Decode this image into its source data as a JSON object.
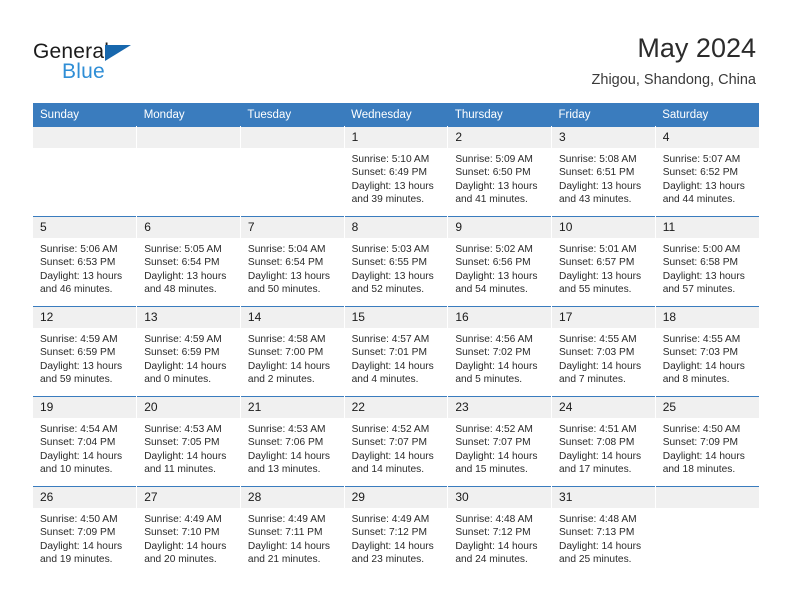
{
  "brand": {
    "name_part1": "General",
    "name_part2": "Blue",
    "triangle_color": "#1767ad",
    "blue_color": "#2f8ed6"
  },
  "header": {
    "title": "May 2024",
    "subtitle": "Zhigou, Shandong, China"
  },
  "theme": {
    "header_row_bg": "#3a7cbe",
    "daynum_bg": "#f0f0f0",
    "cell_bg": "#ffffff",
    "text_color": "#2a2a2a"
  },
  "weekday_headers": [
    "Sunday",
    "Monday",
    "Tuesday",
    "Wednesday",
    "Thursday",
    "Friday",
    "Saturday"
  ],
  "weeks": [
    [
      {
        "day": "",
        "empty": true,
        "sunrise": "",
        "sunset": "",
        "daylight_line1": "",
        "daylight_line2": ""
      },
      {
        "day": "",
        "empty": true,
        "sunrise": "",
        "sunset": "",
        "daylight_line1": "",
        "daylight_line2": ""
      },
      {
        "day": "",
        "empty": true,
        "sunrise": "",
        "sunset": "",
        "daylight_line1": "",
        "daylight_line2": ""
      },
      {
        "day": "1",
        "empty": false,
        "sunrise": "Sunrise: 5:10 AM",
        "sunset": "Sunset: 6:49 PM",
        "daylight_line1": "Daylight: 13 hours",
        "daylight_line2": "and 39 minutes."
      },
      {
        "day": "2",
        "empty": false,
        "sunrise": "Sunrise: 5:09 AM",
        "sunset": "Sunset: 6:50 PM",
        "daylight_line1": "Daylight: 13 hours",
        "daylight_line2": "and 41 minutes."
      },
      {
        "day": "3",
        "empty": false,
        "sunrise": "Sunrise: 5:08 AM",
        "sunset": "Sunset: 6:51 PM",
        "daylight_line1": "Daylight: 13 hours",
        "daylight_line2": "and 43 minutes."
      },
      {
        "day": "4",
        "empty": false,
        "sunrise": "Sunrise: 5:07 AM",
        "sunset": "Sunset: 6:52 PM",
        "daylight_line1": "Daylight: 13 hours",
        "daylight_line2": "and 44 minutes."
      }
    ],
    [
      {
        "day": "5",
        "empty": false,
        "sunrise": "Sunrise: 5:06 AM",
        "sunset": "Sunset: 6:53 PM",
        "daylight_line1": "Daylight: 13 hours",
        "daylight_line2": "and 46 minutes."
      },
      {
        "day": "6",
        "empty": false,
        "sunrise": "Sunrise: 5:05 AM",
        "sunset": "Sunset: 6:54 PM",
        "daylight_line1": "Daylight: 13 hours",
        "daylight_line2": "and 48 minutes."
      },
      {
        "day": "7",
        "empty": false,
        "sunrise": "Sunrise: 5:04 AM",
        "sunset": "Sunset: 6:54 PM",
        "daylight_line1": "Daylight: 13 hours",
        "daylight_line2": "and 50 minutes."
      },
      {
        "day": "8",
        "empty": false,
        "sunrise": "Sunrise: 5:03 AM",
        "sunset": "Sunset: 6:55 PM",
        "daylight_line1": "Daylight: 13 hours",
        "daylight_line2": "and 52 minutes."
      },
      {
        "day": "9",
        "empty": false,
        "sunrise": "Sunrise: 5:02 AM",
        "sunset": "Sunset: 6:56 PM",
        "daylight_line1": "Daylight: 13 hours",
        "daylight_line2": "and 54 minutes."
      },
      {
        "day": "10",
        "empty": false,
        "sunrise": "Sunrise: 5:01 AM",
        "sunset": "Sunset: 6:57 PM",
        "daylight_line1": "Daylight: 13 hours",
        "daylight_line2": "and 55 minutes."
      },
      {
        "day": "11",
        "empty": false,
        "sunrise": "Sunrise: 5:00 AM",
        "sunset": "Sunset: 6:58 PM",
        "daylight_line1": "Daylight: 13 hours",
        "daylight_line2": "and 57 minutes."
      }
    ],
    [
      {
        "day": "12",
        "empty": false,
        "sunrise": "Sunrise: 4:59 AM",
        "sunset": "Sunset: 6:59 PM",
        "daylight_line1": "Daylight: 13 hours",
        "daylight_line2": "and 59 minutes."
      },
      {
        "day": "13",
        "empty": false,
        "sunrise": "Sunrise: 4:59 AM",
        "sunset": "Sunset: 6:59 PM",
        "daylight_line1": "Daylight: 14 hours",
        "daylight_line2": "and 0 minutes."
      },
      {
        "day": "14",
        "empty": false,
        "sunrise": "Sunrise: 4:58 AM",
        "sunset": "Sunset: 7:00 PM",
        "daylight_line1": "Daylight: 14 hours",
        "daylight_line2": "and 2 minutes."
      },
      {
        "day": "15",
        "empty": false,
        "sunrise": "Sunrise: 4:57 AM",
        "sunset": "Sunset: 7:01 PM",
        "daylight_line1": "Daylight: 14 hours",
        "daylight_line2": "and 4 minutes."
      },
      {
        "day": "16",
        "empty": false,
        "sunrise": "Sunrise: 4:56 AM",
        "sunset": "Sunset: 7:02 PM",
        "daylight_line1": "Daylight: 14 hours",
        "daylight_line2": "and 5 minutes."
      },
      {
        "day": "17",
        "empty": false,
        "sunrise": "Sunrise: 4:55 AM",
        "sunset": "Sunset: 7:03 PM",
        "daylight_line1": "Daylight: 14 hours",
        "daylight_line2": "and 7 minutes."
      },
      {
        "day": "18",
        "empty": false,
        "sunrise": "Sunrise: 4:55 AM",
        "sunset": "Sunset: 7:03 PM",
        "daylight_line1": "Daylight: 14 hours",
        "daylight_line2": "and 8 minutes."
      }
    ],
    [
      {
        "day": "19",
        "empty": false,
        "sunrise": "Sunrise: 4:54 AM",
        "sunset": "Sunset: 7:04 PM",
        "daylight_line1": "Daylight: 14 hours",
        "daylight_line2": "and 10 minutes."
      },
      {
        "day": "20",
        "empty": false,
        "sunrise": "Sunrise: 4:53 AM",
        "sunset": "Sunset: 7:05 PM",
        "daylight_line1": "Daylight: 14 hours",
        "daylight_line2": "and 11 minutes."
      },
      {
        "day": "21",
        "empty": false,
        "sunrise": "Sunrise: 4:53 AM",
        "sunset": "Sunset: 7:06 PM",
        "daylight_line1": "Daylight: 14 hours",
        "daylight_line2": "and 13 minutes."
      },
      {
        "day": "22",
        "empty": false,
        "sunrise": "Sunrise: 4:52 AM",
        "sunset": "Sunset: 7:07 PM",
        "daylight_line1": "Daylight: 14 hours",
        "daylight_line2": "and 14 minutes."
      },
      {
        "day": "23",
        "empty": false,
        "sunrise": "Sunrise: 4:52 AM",
        "sunset": "Sunset: 7:07 PM",
        "daylight_line1": "Daylight: 14 hours",
        "daylight_line2": "and 15 minutes."
      },
      {
        "day": "24",
        "empty": false,
        "sunrise": "Sunrise: 4:51 AM",
        "sunset": "Sunset: 7:08 PM",
        "daylight_line1": "Daylight: 14 hours",
        "daylight_line2": "and 17 minutes."
      },
      {
        "day": "25",
        "empty": false,
        "sunrise": "Sunrise: 4:50 AM",
        "sunset": "Sunset: 7:09 PM",
        "daylight_line1": "Daylight: 14 hours",
        "daylight_line2": "and 18 minutes."
      }
    ],
    [
      {
        "day": "26",
        "empty": false,
        "sunrise": "Sunrise: 4:50 AM",
        "sunset": "Sunset: 7:09 PM",
        "daylight_line1": "Daylight: 14 hours",
        "daylight_line2": "and 19 minutes."
      },
      {
        "day": "27",
        "empty": false,
        "sunrise": "Sunrise: 4:49 AM",
        "sunset": "Sunset: 7:10 PM",
        "daylight_line1": "Daylight: 14 hours",
        "daylight_line2": "and 20 minutes."
      },
      {
        "day": "28",
        "empty": false,
        "sunrise": "Sunrise: 4:49 AM",
        "sunset": "Sunset: 7:11 PM",
        "daylight_line1": "Daylight: 14 hours",
        "daylight_line2": "and 21 minutes."
      },
      {
        "day": "29",
        "empty": false,
        "sunrise": "Sunrise: 4:49 AM",
        "sunset": "Sunset: 7:12 PM",
        "daylight_line1": "Daylight: 14 hours",
        "daylight_line2": "and 23 minutes."
      },
      {
        "day": "30",
        "empty": false,
        "sunrise": "Sunrise: 4:48 AM",
        "sunset": "Sunset: 7:12 PM",
        "daylight_line1": "Daylight: 14 hours",
        "daylight_line2": "and 24 minutes."
      },
      {
        "day": "31",
        "empty": false,
        "sunrise": "Sunrise: 4:48 AM",
        "sunset": "Sunset: 7:13 PM",
        "daylight_line1": "Daylight: 14 hours",
        "daylight_line2": "and 25 minutes."
      },
      {
        "day": "",
        "empty": true,
        "sunrise": "",
        "sunset": "",
        "daylight_line1": "",
        "daylight_line2": ""
      }
    ]
  ]
}
